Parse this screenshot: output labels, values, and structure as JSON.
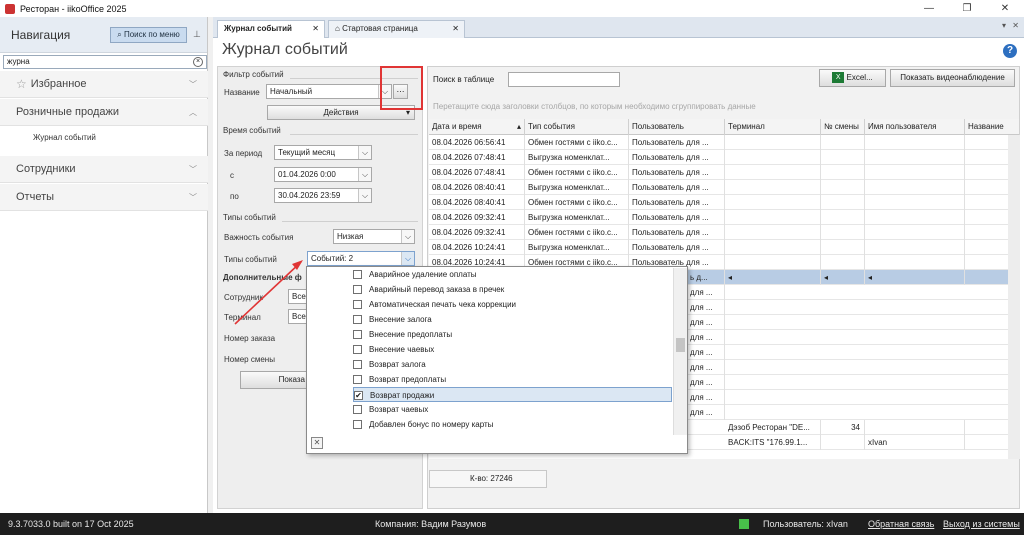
{
  "window": {
    "title": "Ресторан - iikoOffice 2025"
  },
  "nav": {
    "title": "Навигация",
    "search_btn": "Поиск по меню",
    "filter_value": "журна",
    "sections": [
      "Избранное",
      "Розничные продажи",
      "Сотрудники",
      "Отчеты"
    ],
    "sub_item": "Журнал событий"
  },
  "tabs": [
    "Журнал событий",
    "Стартовая страница"
  ],
  "page": {
    "title": "Журнал событий"
  },
  "filters": {
    "filter_group": "Фильтр событий",
    "name_label": "Название",
    "name_value": "Начальный",
    "actions_btn": "Действия",
    "time_group": "Время событий",
    "period_label": "За период",
    "period_value": "Текущий месяц",
    "from_label": "с",
    "from_value": "01.04.2026 0:00",
    "to_label": "по",
    "to_value": "30.04.2026 23:59",
    "types_group": "Типы событий",
    "importance_label": "Важность события",
    "importance_value": "Низкая",
    "types_label": "Типы событий",
    "types_value": "Событий: 2",
    "extra_group": "Дополнительные ф",
    "employee_label": "Сотрудник",
    "employee_value": "Все",
    "terminal_label": "Терминал",
    "terminal_value": "Все",
    "order_label": "Номер заказа",
    "shift_label": "Номер смены",
    "show_btn": "Показа"
  },
  "grid": {
    "search_label": "Поиск в таблице",
    "excel_btn": "Excel...",
    "video_btn": "Показать видеонаблюдение",
    "group_hint": "Перетащите сюда заголовки столбцов, по которым необходимо сгруппировать данные",
    "columns": [
      "Дата и время",
      "Тип события",
      "Пользователь",
      "Терминал",
      "№ смены",
      "Имя пользователя",
      "Название"
    ],
    "rows": [
      [
        "08.04.2026 06:56:41",
        "Обмен гостями с iiko.c...",
        "Пользователь для ...",
        "",
        "",
        "",
        ""
      ],
      [
        "08.04.2026 07:48:41",
        "Выгрузка номенклат...",
        "Пользователь для ...",
        "",
        "",
        "",
        ""
      ],
      [
        "08.04.2026 07:48:41",
        "Обмен гостями с iiko.c...",
        "Пользователь для ...",
        "",
        "",
        "",
        ""
      ],
      [
        "08.04.2026 08:40:41",
        "Выгрузка номенклат...",
        "Пользователь для ...",
        "",
        "",
        "",
        ""
      ],
      [
        "08.04.2026 08:40:41",
        "Обмен гостями с iiko.c...",
        "Пользователь для ...",
        "",
        "",
        "",
        ""
      ],
      [
        "08.04.2026 09:32:41",
        "Выгрузка номенклат...",
        "Пользователь для ...",
        "",
        "",
        "",
        ""
      ],
      [
        "08.04.2026 09:32:41",
        "Обмен гостями с iiko.c...",
        "Пользователь для ...",
        "",
        "",
        "",
        ""
      ],
      [
        "08.04.2026 10:24:41",
        "Выгрузка номенклат...",
        "Пользователь для ...",
        "",
        "",
        "",
        ""
      ],
      [
        "08.04.2026 10:24:41",
        "Обмен гостями с iiko.c...",
        "Пользователь для ...",
        "",
        "",
        "",
        ""
      ]
    ],
    "partial_rows": [
      "ь д...",
      "для ...",
      "для ...",
      "для ...",
      "для ...",
      "для ...",
      "для ...",
      "для ...",
      "для ...",
      "для ..."
    ],
    "extra_rows": [
      {
        "terminal": "Дэзоб Ресторан \"DE...",
        "shift": "34",
        "username": ""
      },
      {
        "terminal": "BACK:ITS \"176.99.1...",
        "shift": "",
        "username": "xIvan"
      }
    ],
    "count": "К-во: 27246"
  },
  "popup": {
    "options": [
      {
        "label": "Аварийное удаление оплаты",
        "checked": false
      },
      {
        "label": "Аварийный перевод заказа в пречек",
        "checked": false
      },
      {
        "label": "Автоматическая печать чека коррекции",
        "checked": false
      },
      {
        "label": "Внесение залога",
        "checked": false
      },
      {
        "label": "Внесение предоплаты",
        "checked": false
      },
      {
        "label": "Внесение чаевых",
        "checked": false
      },
      {
        "label": "Возврат залога",
        "checked": false
      },
      {
        "label": "Возврат предоплаты",
        "checked": false
      },
      {
        "label": "Возврат продажи",
        "checked": true
      },
      {
        "label": "Возврат чаевых",
        "checked": false
      },
      {
        "label": "Добавлен бонус по номеру карты",
        "checked": false
      }
    ]
  },
  "status": {
    "version": "9.3.7033.0 built on 17 Oct 2025",
    "company": "Компания: Вадим Разумов",
    "user": "Пользователь: xIvan",
    "feedback": "Обратная связь",
    "logout": "Выход из системы"
  },
  "colors": {
    "accent": "#2d6fc0",
    "selection": "#b8cce4",
    "highlight": "#e03535",
    "status_ok": "#48c04a"
  }
}
